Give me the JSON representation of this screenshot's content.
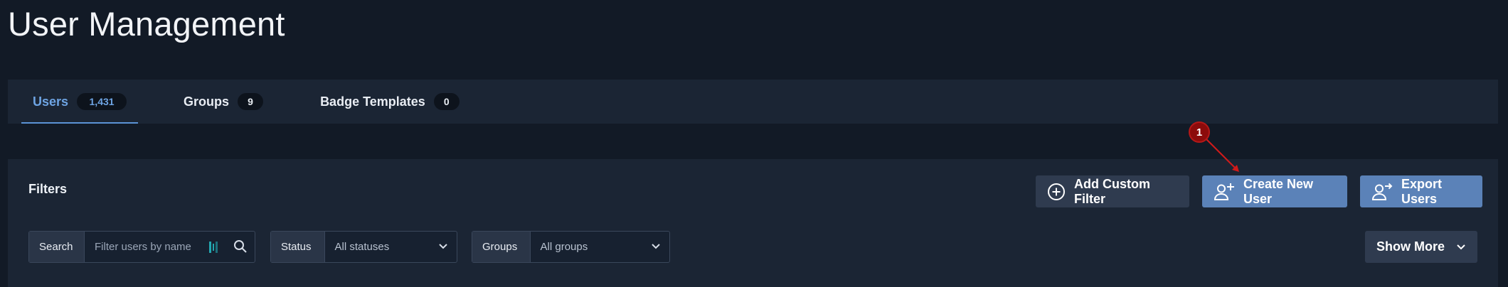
{
  "page": {
    "title": "User Management"
  },
  "tabs": [
    {
      "label": "Users",
      "count": "1,431",
      "active": true
    },
    {
      "label": "Groups",
      "count": "9",
      "active": false
    },
    {
      "label": "Badge Templates",
      "count": "0",
      "active": false
    }
  ],
  "filters": {
    "heading": "Filters",
    "search": {
      "label": "Search",
      "placeholder": "Filter users by name"
    },
    "status": {
      "label": "Status",
      "value": "All statuses"
    },
    "groups": {
      "label": "Groups",
      "value": "All groups"
    },
    "show_more": "Show More"
  },
  "actions": {
    "add_custom_filter": "Add Custom Filter",
    "create_new_user": "Create New User",
    "export_users": "Export Users"
  },
  "annotation": {
    "number": "1"
  },
  "colors": {
    "background": "#121a26",
    "panel": "#1b2534",
    "accent": "#6ea4e3",
    "primary_button": "#5b82b8",
    "annotation": "#8c0b0b"
  }
}
